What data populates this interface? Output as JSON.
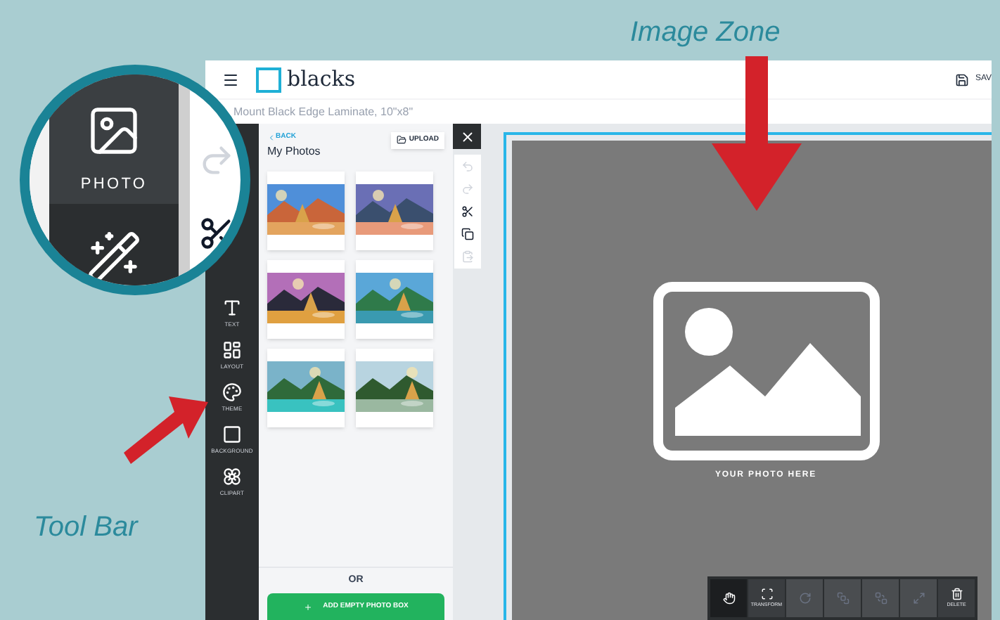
{
  "annotations": [
    {
      "kind": "image-zone",
      "label": "Image Zone"
    },
    {
      "kind": "tool-bar",
      "label": "Tool Bar"
    }
  ],
  "magnifier": {
    "items": [
      {
        "label": "PHOTO",
        "selected": true
      },
      {
        "kind": "magic",
        "selected": false
      }
    ]
  },
  "header": {
    "logo": "blacks",
    "save": "SAV"
  },
  "product_title": "Mount Black Edge Laminate, 10\"x8\"",
  "toolbar": [
    {
      "kind": "text",
      "label": "TEXT"
    },
    {
      "kind": "layout",
      "label": "LAYOUT"
    },
    {
      "kind": "theme",
      "label": "THEME"
    },
    {
      "kind": "background",
      "label": "BACKGROUND"
    },
    {
      "kind": "clipart",
      "label": "CLIPART"
    }
  ],
  "panel": {
    "back": "BACK",
    "title": "My Photos",
    "upload": "UPLOAD",
    "or": "OR",
    "add_button": "ADD EMPTY PHOTO BOX"
  },
  "edit_tools": [
    {
      "kind": "undo",
      "disabled": true
    },
    {
      "kind": "redo",
      "disabled": true
    },
    {
      "kind": "cut",
      "disabled": false
    },
    {
      "kind": "copy",
      "disabled": false
    },
    {
      "kind": "paste",
      "disabled": true
    }
  ],
  "canvas": {
    "placeholder": "YOUR PHOTO HERE"
  },
  "bottom_tools": [
    {
      "kind": "pan",
      "selected": true,
      "disabled": false
    },
    {
      "kind": "transform",
      "label": "TRANSFORM",
      "selected": false,
      "disabled": false
    },
    {
      "kind": "rotate",
      "selected": false,
      "disabled": true
    },
    {
      "kind": "front",
      "selected": false,
      "disabled": true
    },
    {
      "kind": "back",
      "selected": false,
      "disabled": true
    },
    {
      "kind": "resize",
      "selected": false,
      "disabled": true
    },
    {
      "kind": "delete",
      "label": "DELETE",
      "selected": false,
      "disabled": false
    }
  ]
}
